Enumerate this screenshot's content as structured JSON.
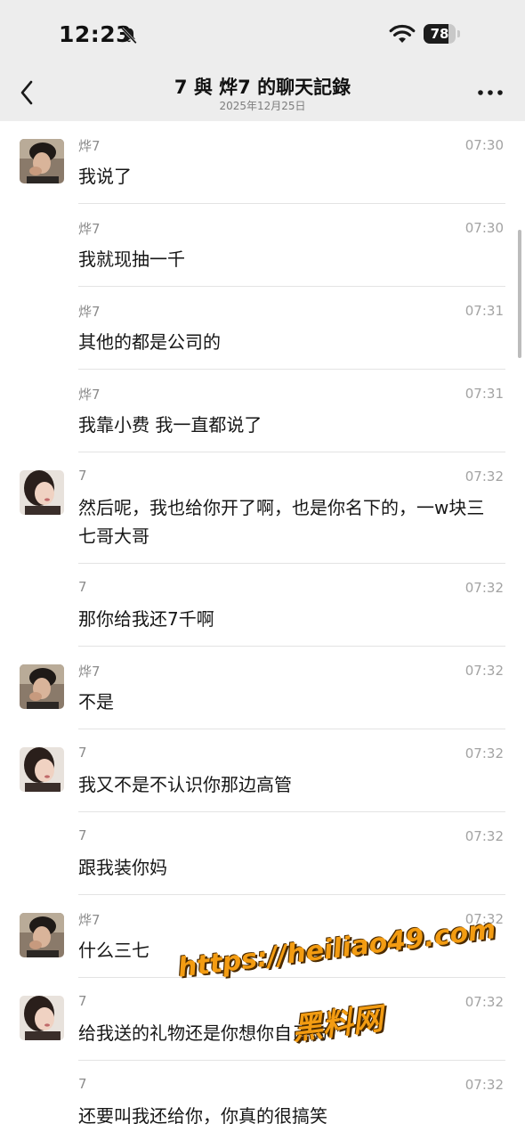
{
  "status_bar": {
    "time": "12:23",
    "battery_level": "78",
    "battery_fraction": 0.78,
    "icons": [
      "bell-slash-icon",
      "wifi-icon",
      "battery-icon"
    ]
  },
  "nav": {
    "title": "7 與 烨7 的聊天記錄",
    "date": "2025年12月25日",
    "icons": [
      "chevron-left-icon",
      "more-icon"
    ]
  },
  "messages": [
    {
      "sender": "烨7",
      "time": "07:30",
      "text": "我说了",
      "show_avatar": true,
      "avatar": "a"
    },
    {
      "sender": "烨7",
      "time": "07:30",
      "text": "我就现抽一千",
      "show_avatar": false
    },
    {
      "sender": "烨7",
      "time": "07:31",
      "text": "其他的都是公司的",
      "show_avatar": false
    },
    {
      "sender": "烨7",
      "time": "07:31",
      "text": "我靠小费 我一直都说了",
      "show_avatar": false
    },
    {
      "sender": "7",
      "time": "07:32",
      "text": "然后呢，我也给你开了啊，也是你名下的，一w块三七哥大哥",
      "show_avatar": true,
      "avatar": "b"
    },
    {
      "sender": "7",
      "time": "07:32",
      "text": "那你给我还7千啊",
      "show_avatar": false
    },
    {
      "sender": "烨7",
      "time": "07:32",
      "text": "不是",
      "show_avatar": true,
      "avatar": "a"
    },
    {
      "sender": "7",
      "time": "07:32",
      "text": "我又不是不认识你那边高管",
      "show_avatar": true,
      "avatar": "b"
    },
    {
      "sender": "7",
      "time": "07:32",
      "text": "跟我装你妈",
      "show_avatar": false
    },
    {
      "sender": "烨7",
      "time": "07:32",
      "text": "什么三七",
      "show_avatar": true,
      "avatar": "a"
    },
    {
      "sender": "7",
      "time": "07:32",
      "text": "给我送的礼物还是你想你自己的",
      "show_avatar": true,
      "avatar": "b"
    },
    {
      "sender": "7",
      "time": "07:32",
      "text": "还要叫我还给你，你真的很搞笑",
      "show_avatar": false
    }
  ],
  "watermark": {
    "url": "https://heiliao49.com",
    "brand": "黑料网"
  },
  "colors": {
    "header_bg": "#ededed",
    "text": "#161616",
    "meta": "#a3a3a3",
    "watermark": "#f39c12"
  }
}
